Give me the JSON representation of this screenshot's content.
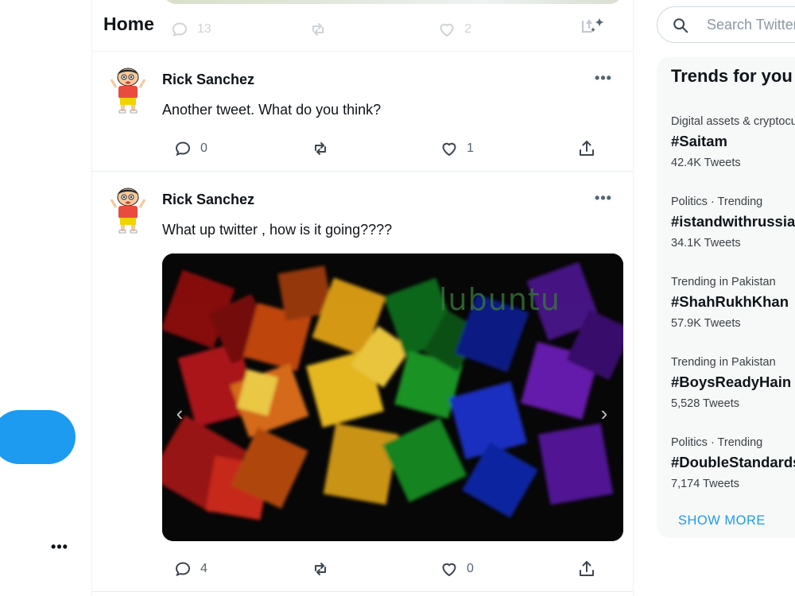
{
  "header": {
    "title": "Home",
    "previous_tweet": {
      "replies": "13",
      "likes": "2"
    }
  },
  "left_nav": {
    "more_label": "•••"
  },
  "tweets": [
    {
      "author": "Rick Sanchez",
      "text": "Another tweet. What do you think?",
      "replies": "0",
      "likes": "1",
      "more_label": "•••"
    },
    {
      "author": "Rick Sanchez",
      "text": "What up twitter , how is it going????",
      "replies": "4",
      "likes": "0",
      "more_label": "•••",
      "media": {
        "watermark": "lubuntu",
        "prev_label": "‹",
        "next_label": "›"
      }
    }
  ],
  "search": {
    "placeholder": "Search Twitter"
  },
  "trends": {
    "title": "Trends for you",
    "items": [
      {
        "context": "Digital assets & cryptocurrency",
        "name": "#Saitam",
        "count": "42.4K Tweets"
      },
      {
        "context": "Politics · Trending",
        "name": "#istandwithrussia",
        "count": "34.1K Tweets"
      },
      {
        "context": "Trending in Pakistan",
        "name": "#ShahRukhKhan",
        "count": "57.9K Tweets"
      },
      {
        "context": "Trending in Pakistan",
        "name": "#BoysReadyHain",
        "count": "5,528 Tweets"
      },
      {
        "context": "Politics · Trending",
        "name": "#DoubleStandards",
        "count": "7,174 Tweets"
      }
    ],
    "show_more": "SHOW MORE"
  },
  "icons": {
    "reply": "speech-bubble-icon",
    "retweet": "retweet-arrows-icon",
    "like": "heart-icon",
    "share": "share-upload-icon",
    "sparkle": "sparkle-top-tweets-icon",
    "search": "magnifier-icon"
  },
  "colors": {
    "accent": "#1d9bf0",
    "text": "#0f1419",
    "muted": "#536471",
    "panel": "#f7f9f9"
  }
}
